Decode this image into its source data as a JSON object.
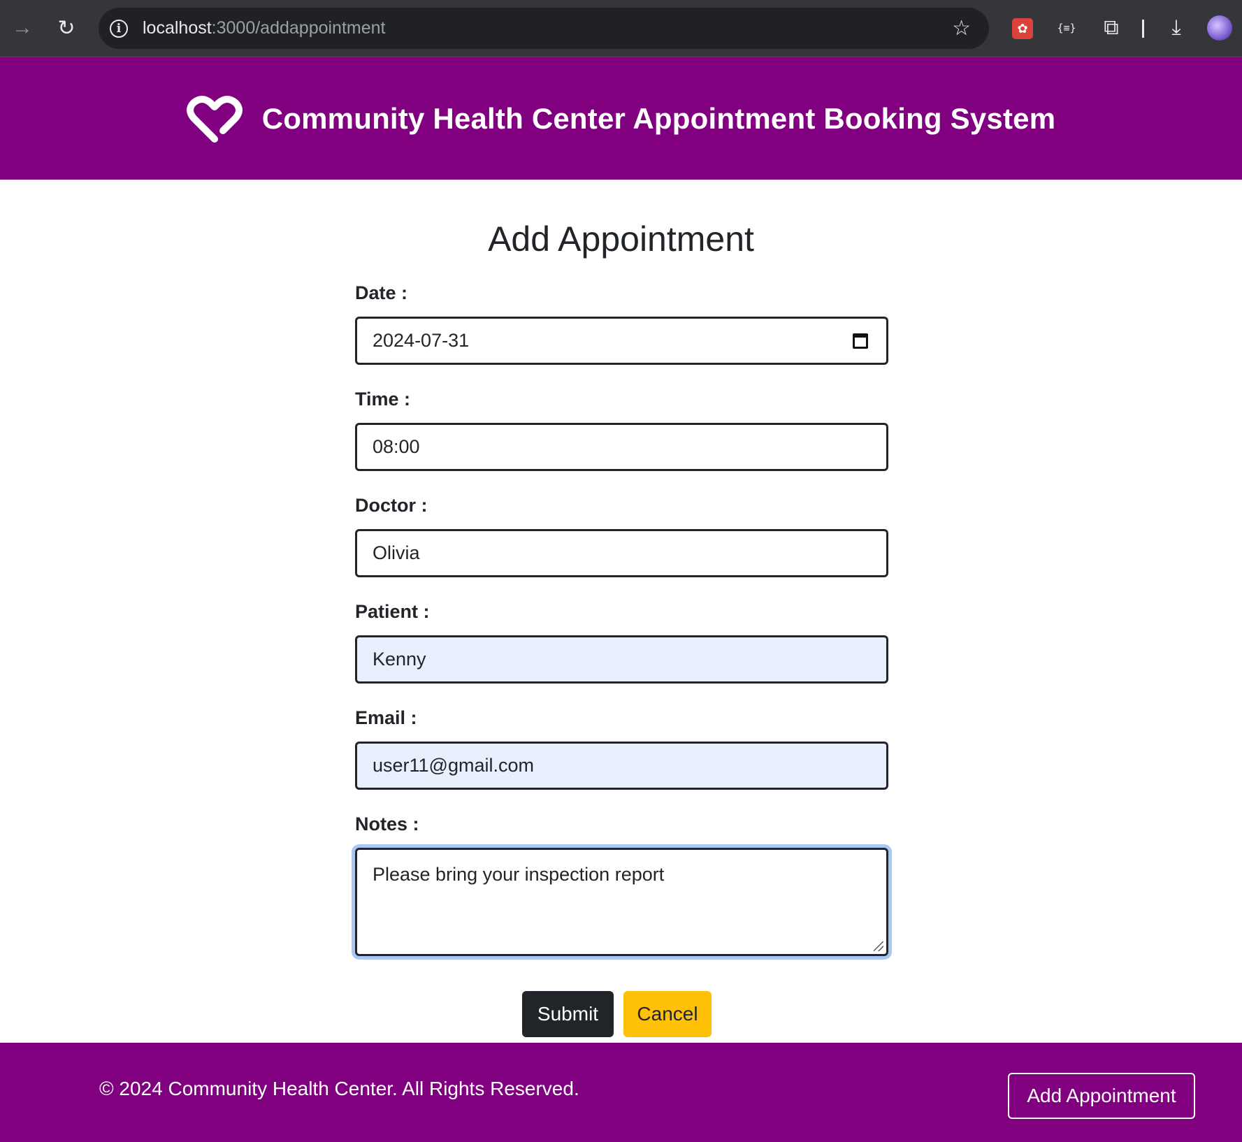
{
  "browser": {
    "url_host": "localhost",
    "url_path": ":3000/addappointment",
    "colors": {
      "chrome_bg": "#35363a",
      "urlbar_bg": "#202124"
    }
  },
  "header": {
    "title": "Community Health Center Appointment Booking System",
    "logo_icon": "heart-logo-icon",
    "background": "#800080"
  },
  "form": {
    "title": "Add Appointment",
    "fields": {
      "date": {
        "label": "Date :",
        "value": "2024-07-31"
      },
      "time": {
        "label": "Time :",
        "value": "08:00"
      },
      "doctor": {
        "label": "Doctor :",
        "value": "Olivia"
      },
      "patient": {
        "label": "Patient :",
        "value": "Kenny"
      },
      "email": {
        "label": "Email :",
        "value": "user11@gmail.com"
      },
      "notes": {
        "label": "Notes :",
        "value": "Please bring your inspection report"
      }
    },
    "submit_label": "Submit",
    "cancel_label": "Cancel",
    "colors": {
      "submit": "#212529",
      "cancel": "#ffc107",
      "autofill": "#e8f0fe"
    }
  },
  "footer": {
    "copyright": "© 2024 Community Health Center. All Rights Reserved.",
    "button_label": "Add Appointment"
  }
}
